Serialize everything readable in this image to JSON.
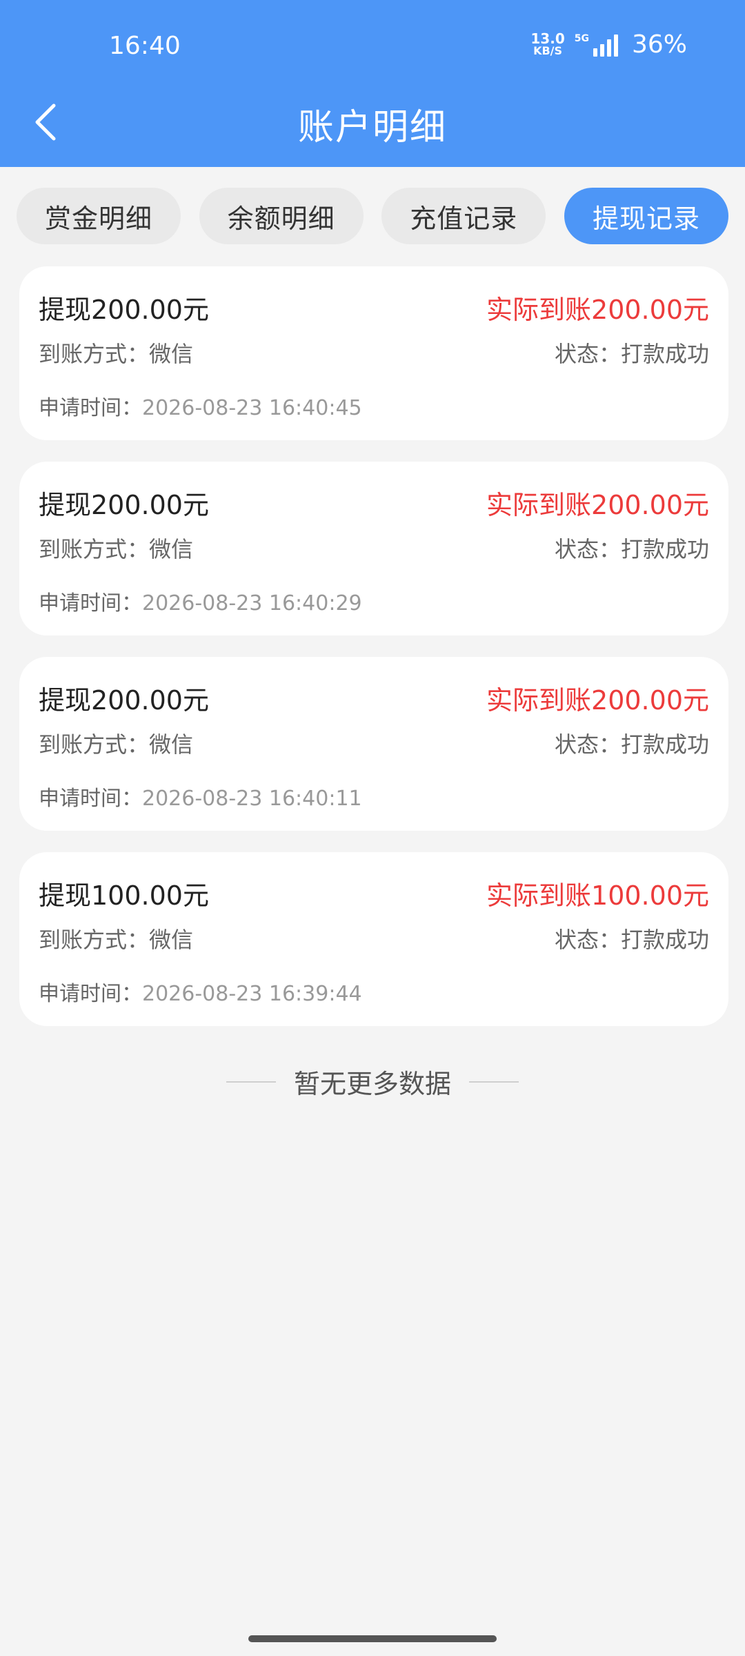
{
  "status_bar": {
    "time": "16:40",
    "net_speed_value": "13.0",
    "net_speed_unit": "KB/S",
    "network": "5G",
    "battery": "36%"
  },
  "header": {
    "title": "账户明细",
    "back_icon": "chevron-left-icon"
  },
  "tabs": [
    {
      "label": "赏金明细",
      "active": false
    },
    {
      "label": "余额明细",
      "active": false
    },
    {
      "label": "充值记录",
      "active": false
    },
    {
      "label": "提现记录",
      "active": true
    }
  ],
  "records": [
    {
      "title": "提现200.00元",
      "actual": "实际到账200.00元",
      "method_label": "到账方式：",
      "method": "微信",
      "status_label": "状态：",
      "status": "打款成功",
      "time_label": "申请时间：",
      "time": "2026-08-23 16:40:45"
    },
    {
      "title": "提现200.00元",
      "actual": "实际到账200.00元",
      "method_label": "到账方式：",
      "method": "微信",
      "status_label": "状态：",
      "status": "打款成功",
      "time_label": "申请时间：",
      "time": "2026-08-23 16:40:29"
    },
    {
      "title": "提现200.00元",
      "actual": "实际到账200.00元",
      "method_label": "到账方式：",
      "method": "微信",
      "status_label": "状态：",
      "status": "打款成功",
      "time_label": "申请时间：",
      "time": "2026-08-23 16:40:11"
    },
    {
      "title": "提现100.00元",
      "actual": "实际到账100.00元",
      "method_label": "到账方式：",
      "method": "微信",
      "status_label": "状态：",
      "status": "打款成功",
      "time_label": "申请时间：",
      "time": "2026-08-23 16:39:44"
    }
  ],
  "footer": {
    "no_more": "暂无更多数据"
  },
  "colors": {
    "primary": "#4d96f7",
    "accent_red": "#ec3b3b",
    "background": "#f4f4f4"
  }
}
